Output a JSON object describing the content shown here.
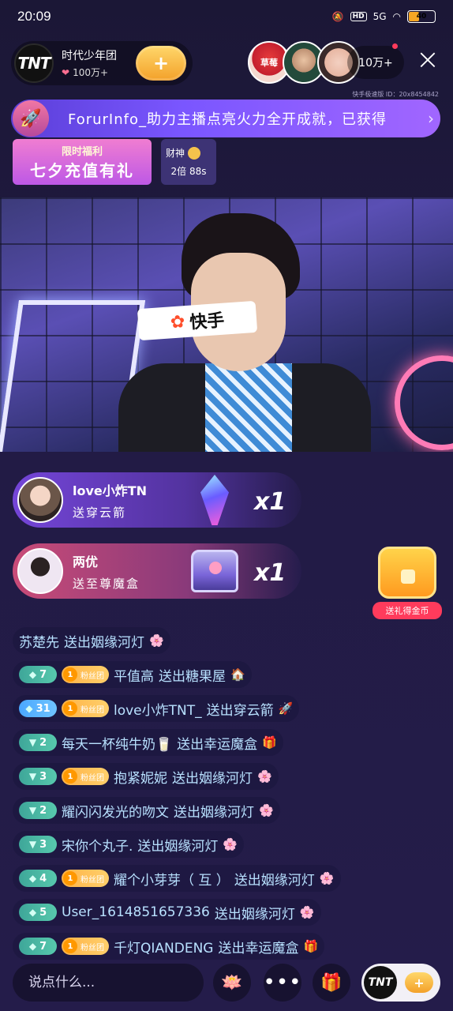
{
  "status_bar": {
    "time": "20:09",
    "network": "5G",
    "hd": "HD",
    "battery": "40",
    "battery_level": 0.4
  },
  "host": {
    "avatar_text": "TNT",
    "name": "时代少年团",
    "likes": "100万+",
    "follow_label": "+"
  },
  "viewers": {
    "count": "10万+",
    "top_avatar_label": "草莓"
  },
  "room_id": "快手极速版 ID：20x8454842",
  "banner": {
    "text": "ForurInfo_助力主播点亮火力全开成就，已获得"
  },
  "promo": {
    "small": "限时福利",
    "big": "七夕充值有礼"
  },
  "wealth": {
    "title": "财神",
    "status": "2倍 88s"
  },
  "video": {
    "mic_logo": "快手"
  },
  "gift_notices": [
    {
      "name": "love小炸TN",
      "gift": "送穿云箭",
      "count": "x1"
    },
    {
      "name": "两优",
      "gift": "送至尊魔盒",
      "count": "x1"
    }
  ],
  "gold_chest": {
    "label": "送礼得金币"
  },
  "comments": [
    {
      "level": "",
      "fan": "",
      "user": "苏楚先",
      "message": "送出姻缘河灯",
      "gift_icon": "🌸"
    },
    {
      "level": "7",
      "fan": "粉丝团",
      "fan_level": "1",
      "user": "平值高",
      "message": "送出糖果屋",
      "gift_icon": "🏠"
    },
    {
      "level": "31",
      "fan": "粉丝团",
      "fan_level": "1",
      "user": "love小炸TNT_",
      "message": "送出穿云箭",
      "gift_icon": "🚀"
    },
    {
      "level": "2",
      "fan": "",
      "user": "每天一杯纯牛奶🥛",
      "message": "送出幸运魔盒",
      "gift_icon": "🎁"
    },
    {
      "level": "3",
      "fan": "粉丝团",
      "fan_level": "1",
      "user": "抱紧妮妮",
      "message": "送出姻缘河灯",
      "gift_icon": "🌸"
    },
    {
      "level": "2",
      "fan": "",
      "user": "耀闪闪发光的吻文",
      "message": "送出姻缘河灯",
      "gift_icon": "🌸"
    },
    {
      "level": "3",
      "fan": "",
      "user": "宋你个丸子.",
      "message": "送出姻缘河灯",
      "gift_icon": "🌸"
    },
    {
      "level": "4",
      "fan": "粉丝团",
      "fan_level": "1",
      "user": "耀个小芽芽（ 互 ）",
      "message": "送出姻缘河灯",
      "gift_icon": "🌸"
    },
    {
      "level": "5",
      "fan": "",
      "user": "User_1614851657336",
      "message": "送出姻缘河灯",
      "gift_icon": "🌸"
    },
    {
      "level": "7",
      "fan": "粉丝团",
      "fan_level": "1",
      "user": "千灯QIANDENG",
      "message": "送出幸运魔盒",
      "gift_icon": "🎁"
    }
  ],
  "bottom_bar": {
    "placeholder": "说点什么...",
    "more_label": "•••",
    "tnt_label": "TNT",
    "plus_label": "+"
  }
}
